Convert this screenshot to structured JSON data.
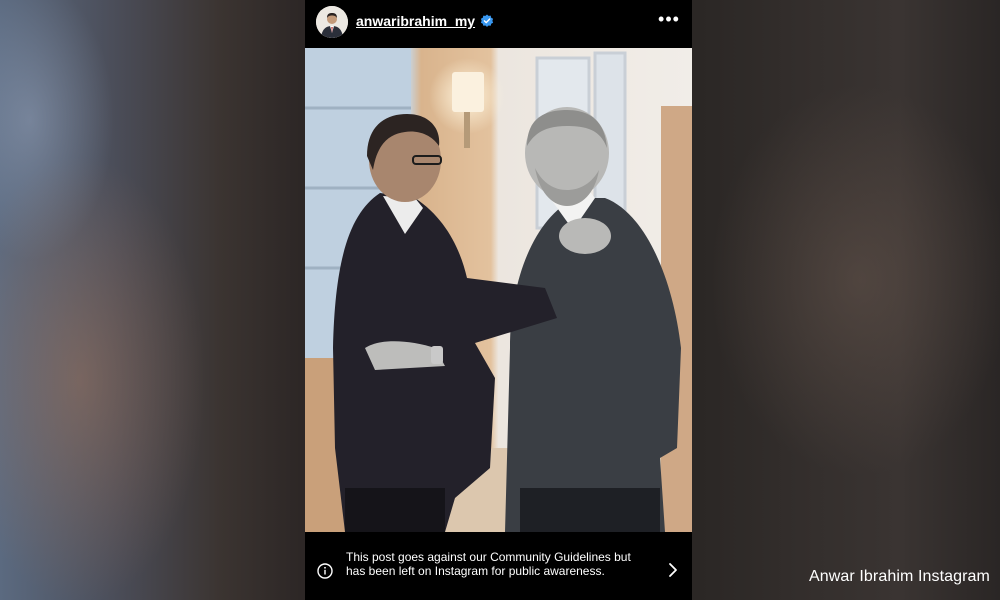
{
  "post": {
    "username": "anwaribrahim_my",
    "verified": true,
    "more_label": "•••",
    "notice_text": "This post goes against our Community Guidelines but has been left on Instagram for public awareness."
  },
  "photo_credit": "Anwar Ibrahim Instagram",
  "colors": {
    "verified_blue": "#3897f0",
    "post_background": "#000000"
  }
}
